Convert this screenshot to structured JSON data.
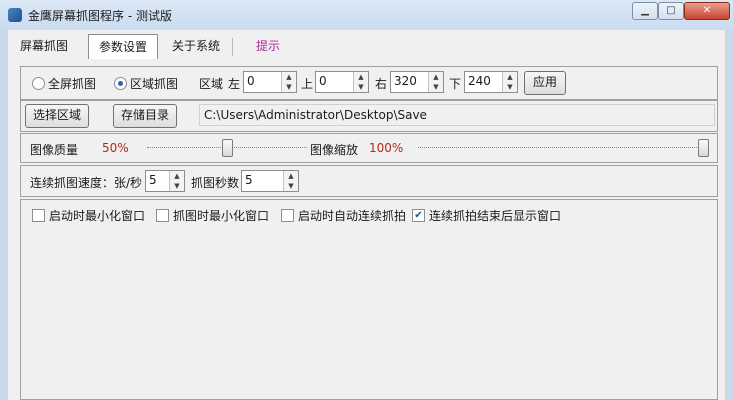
{
  "window": {
    "title": "金鹰屏幕抓图程序 - 测试版"
  },
  "tabs": [
    {
      "label": "屏幕抓图"
    },
    {
      "label": "参数设置"
    },
    {
      "label": "关于系统"
    },
    {
      "label": "提示"
    }
  ],
  "capture": {
    "full_label": "全屏抓图",
    "region_label": "区域抓图",
    "full_selected": false,
    "region_selected": true,
    "area_label": "区域",
    "left_label": "左",
    "left_value": "0",
    "top_label": "上",
    "top_value": "0",
    "right_label": "右",
    "right_value": "320",
    "bottom_label": "下",
    "bottom_value": "240",
    "apply_label": "应用"
  },
  "storage": {
    "select_area_label": "选择区域",
    "save_dir_label": "存储目录",
    "path": "C:\\Users\\Administrator\\Desktop\\Save"
  },
  "image": {
    "quality_label": "图像质量",
    "quality_value": "50%",
    "quality_fraction": 0.5,
    "scale_label": "图像缩放",
    "scale_value": "100%",
    "scale_fraction": 1.0
  },
  "continuous": {
    "speed_label": "连续抓图速度：张/秒",
    "speed_value": "5",
    "seconds_label": "抓图秒数",
    "seconds_value": "5"
  },
  "options": [
    {
      "label": "启动时最小化窗口",
      "checked": false
    },
    {
      "label": "抓图时最小化窗口",
      "checked": false
    },
    {
      "label": "启动时自动连续抓拍",
      "checked": false
    },
    {
      "label": "连续抓拍结束后显示窗口",
      "checked": true
    }
  ]
}
